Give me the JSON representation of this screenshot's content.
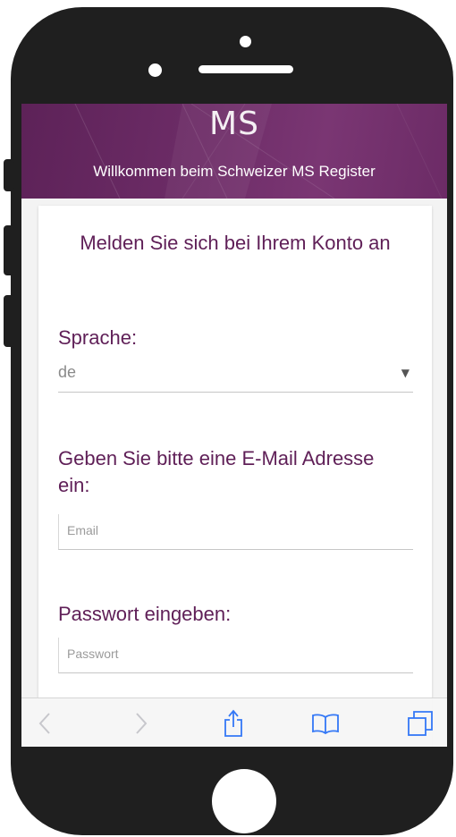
{
  "header": {
    "logo": "MS",
    "subtitle": "Willkommen beim Schweizer MS Register"
  },
  "login": {
    "title": "Melden Sie sich bei Ihrem Konto an",
    "language_label": "Sprache:",
    "language_value": "de",
    "email_label": "Geben Sie bitte eine E-Mail Adresse ein:",
    "email_placeholder": "Email",
    "password_label": "Passwort eingeben:",
    "password_placeholder": "Passwort"
  },
  "toolbar": {
    "items": [
      {
        "icon": "back-arrow-icon",
        "enabled": false
      },
      {
        "icon": "forward-arrow-icon",
        "enabled": false
      },
      {
        "icon": "share-icon",
        "enabled": true
      },
      {
        "icon": "bookmarks-icon",
        "enabled": true
      },
      {
        "icon": "tabs-icon",
        "enabled": true
      }
    ]
  },
  "colors": {
    "brand": "#6e2d68",
    "label_text": "#5f1f57",
    "toolbar_icon": "#3478f6",
    "toolbar_icon_disabled": "#c7c7cc"
  }
}
